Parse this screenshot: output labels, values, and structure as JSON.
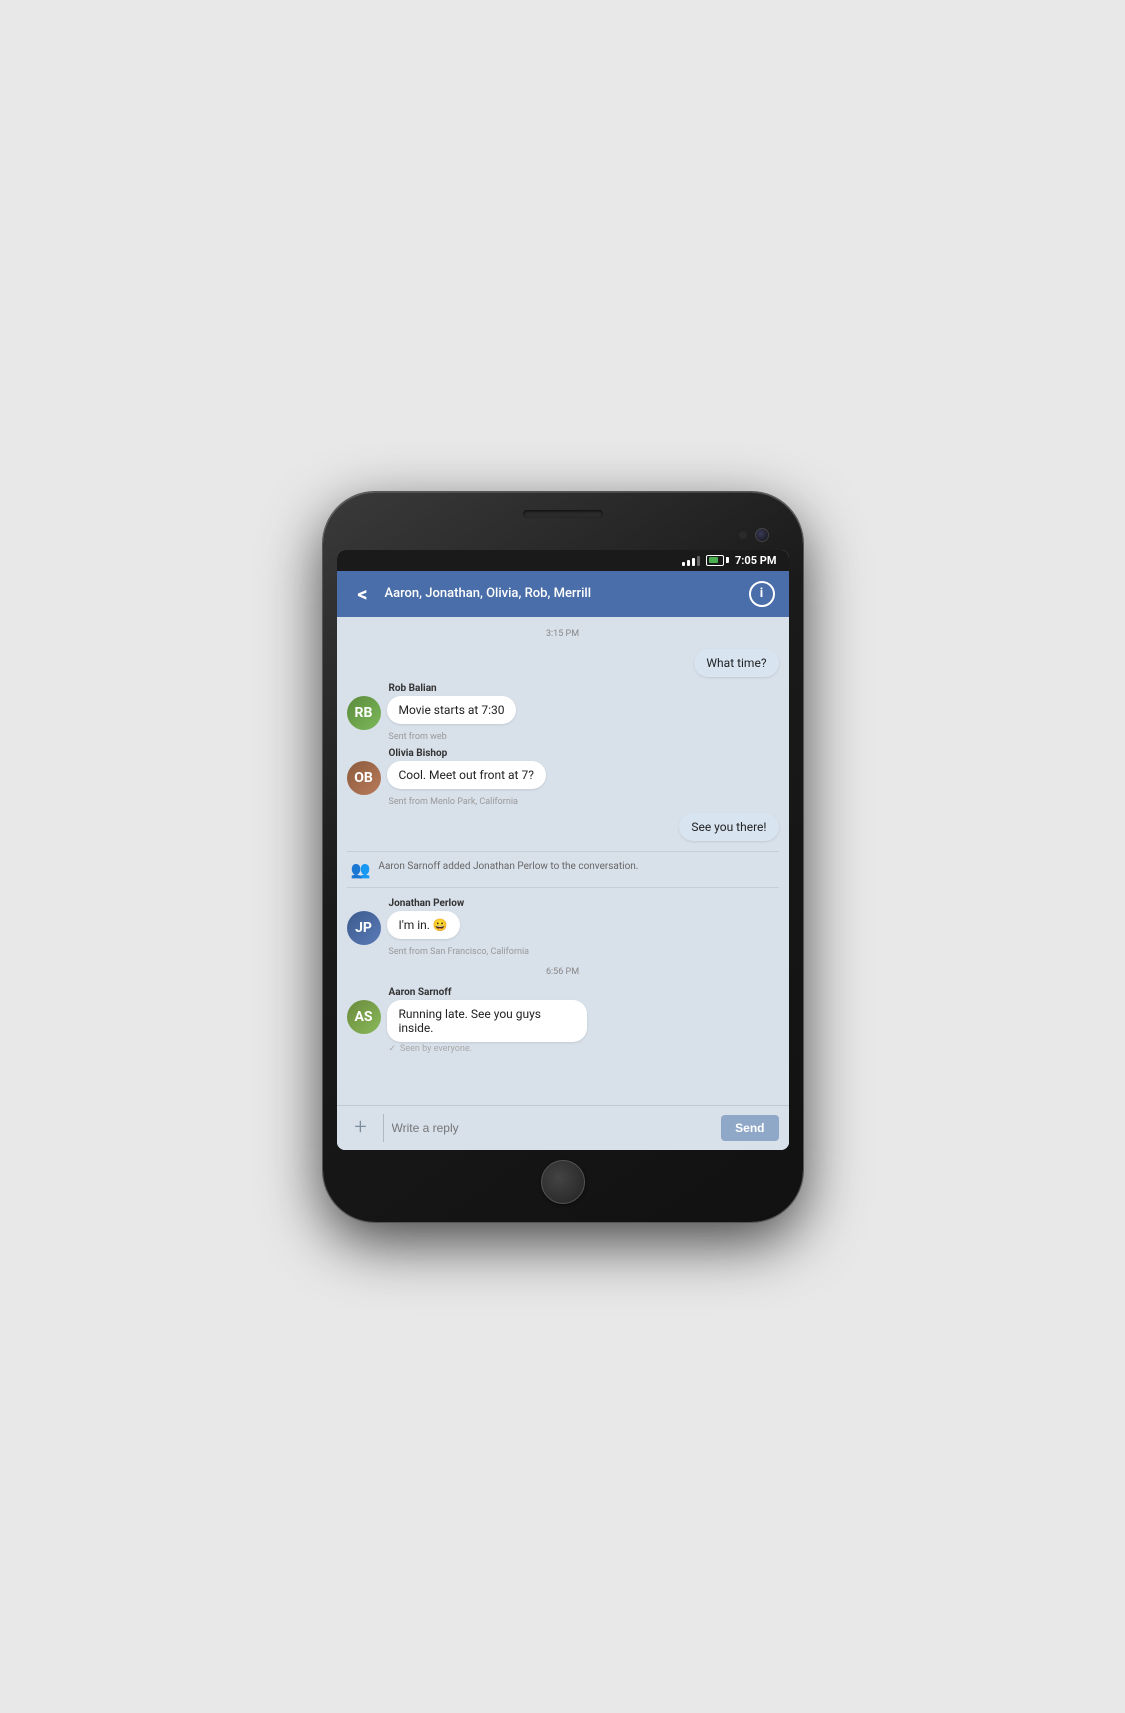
{
  "status_bar": {
    "time": "7:05 PM"
  },
  "header": {
    "back_label": "<",
    "title": "Aaron, Jonathan, Olivia, Rob, Merrill",
    "info_label": "i"
  },
  "messages": [
    {
      "type": "timestamp",
      "value": "3:15 PM"
    },
    {
      "type": "outgoing",
      "text": "What time?"
    },
    {
      "type": "incoming",
      "sender": "Rob Balian",
      "avatar_initials": "RB",
      "avatar_class": "rob",
      "text": "Movie starts at 7:30",
      "subtext": "Sent from web"
    },
    {
      "type": "incoming",
      "sender": "Olivia Bishop",
      "avatar_initials": "OB",
      "avatar_class": "olivia",
      "text": "Cool. Meet out front at 7?",
      "subtext": "Sent from Menlo Park, California"
    },
    {
      "type": "outgoing",
      "text": "See you there!"
    },
    {
      "type": "system",
      "text": "Aaron Sarnoff added Jonathan Perlow to the conversation."
    },
    {
      "type": "incoming",
      "sender": "Jonathan Perlow",
      "avatar_initials": "JP",
      "avatar_class": "jonathan",
      "text": "I'm in. 😀",
      "subtext": "Sent from San Francisco, California"
    },
    {
      "type": "timestamp",
      "value": "6:56 PM"
    },
    {
      "type": "incoming",
      "sender": "Aaron Sarnoff",
      "avatar_initials": "AS",
      "avatar_class": "aaron",
      "text": "Running late. See you guys inside.",
      "subtext": "",
      "seen": "Seen by everyone."
    }
  ],
  "input": {
    "placeholder": "Write a reply",
    "plus_label": "+",
    "send_label": "Send"
  }
}
